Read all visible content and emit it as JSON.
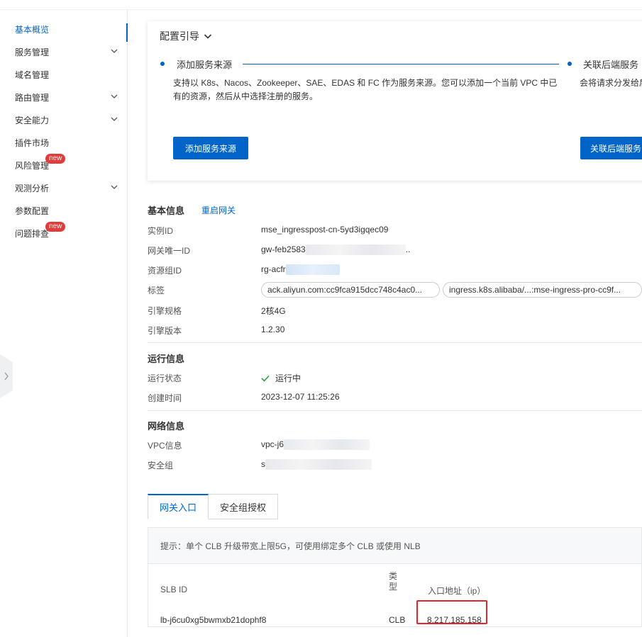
{
  "sidebar": {
    "items": [
      {
        "label": "基本概览",
        "active": true
      },
      {
        "label": "服务管理",
        "expandable": true
      },
      {
        "label": "域名管理"
      },
      {
        "label": "路由管理",
        "expandable": true
      },
      {
        "label": "安全能力",
        "expandable": true
      },
      {
        "label": "插件市场"
      },
      {
        "label": "风险管理",
        "badge": "new"
      },
      {
        "label": "观测分析",
        "expandable": true
      },
      {
        "label": "参数配置"
      },
      {
        "label": "问题排查",
        "badge": "new"
      }
    ]
  },
  "guide": {
    "title": "配置引导",
    "step1": {
      "title": "添加服务来源",
      "desc_line1": "支持以 K8s、Nacos、Zookeeper、SAE、EDAS 和 FC 作为服务来源。您可以添加一个当前 VPC 中已",
      "desc_line2": "有的资源，然后从中选择注册的服务。",
      "button": "添加服务来源"
    },
    "step2": {
      "title": "关联后端服务",
      "desc": "会将请求分发给后",
      "button": "关联后端服务"
    }
  },
  "basic_info": {
    "title": "基本信息",
    "restart_link": "重启网关",
    "rows": {
      "instance_id": {
        "label": "实例ID",
        "value": "mse_ingresspost-cn-5yd3igqec09"
      },
      "gateway_uid": {
        "label": "网关唯一ID",
        "value": "gw-feb2583",
        "suffix": ".."
      },
      "resource_group": {
        "label": "资源组ID",
        "value": "rg-acfr"
      },
      "tags": {
        "label": "标签",
        "values": [
          "ack.aliyun.com:cc9fca915dcc748c4ac0...",
          "ingress.k8s.alibaba/...:mse-ingress-pro-cc9f..."
        ]
      },
      "spec": {
        "label": "引擎规格",
        "value": "2核4G"
      },
      "version": {
        "label": "引擎版本",
        "value": "1.2.30"
      }
    }
  },
  "run_info": {
    "title": "运行信息",
    "status": {
      "label": "运行状态",
      "value": "运行中"
    },
    "created": {
      "label": "创建时间",
      "value": "2023-12-07 11:25:26"
    }
  },
  "network_info": {
    "title": "网络信息",
    "vpc": {
      "label": "VPC信息",
      "value": "vpc-j6"
    },
    "security_group": {
      "label": "安全组",
      "value": "s"
    }
  },
  "tabs": [
    "网关入口",
    "安全组授权"
  ],
  "tip": "提示：单个 CLB 升级带宽上限5G，可使用绑定多个 CLB 或使用 NLB",
  "table": {
    "headers": {
      "slb_id": "SLB ID",
      "type": "类型",
      "ip": "入口地址（ip）"
    },
    "rows": [
      {
        "slb_id": "lb-j6cu0xg5bwmxb21dophf8",
        "type": "CLB",
        "ip": "8.217.185.158"
      }
    ]
  },
  "colors": {
    "accent": "#0064c8",
    "badge": "#e23c39",
    "highlight": "#e0262b",
    "success": "#23a33c"
  }
}
